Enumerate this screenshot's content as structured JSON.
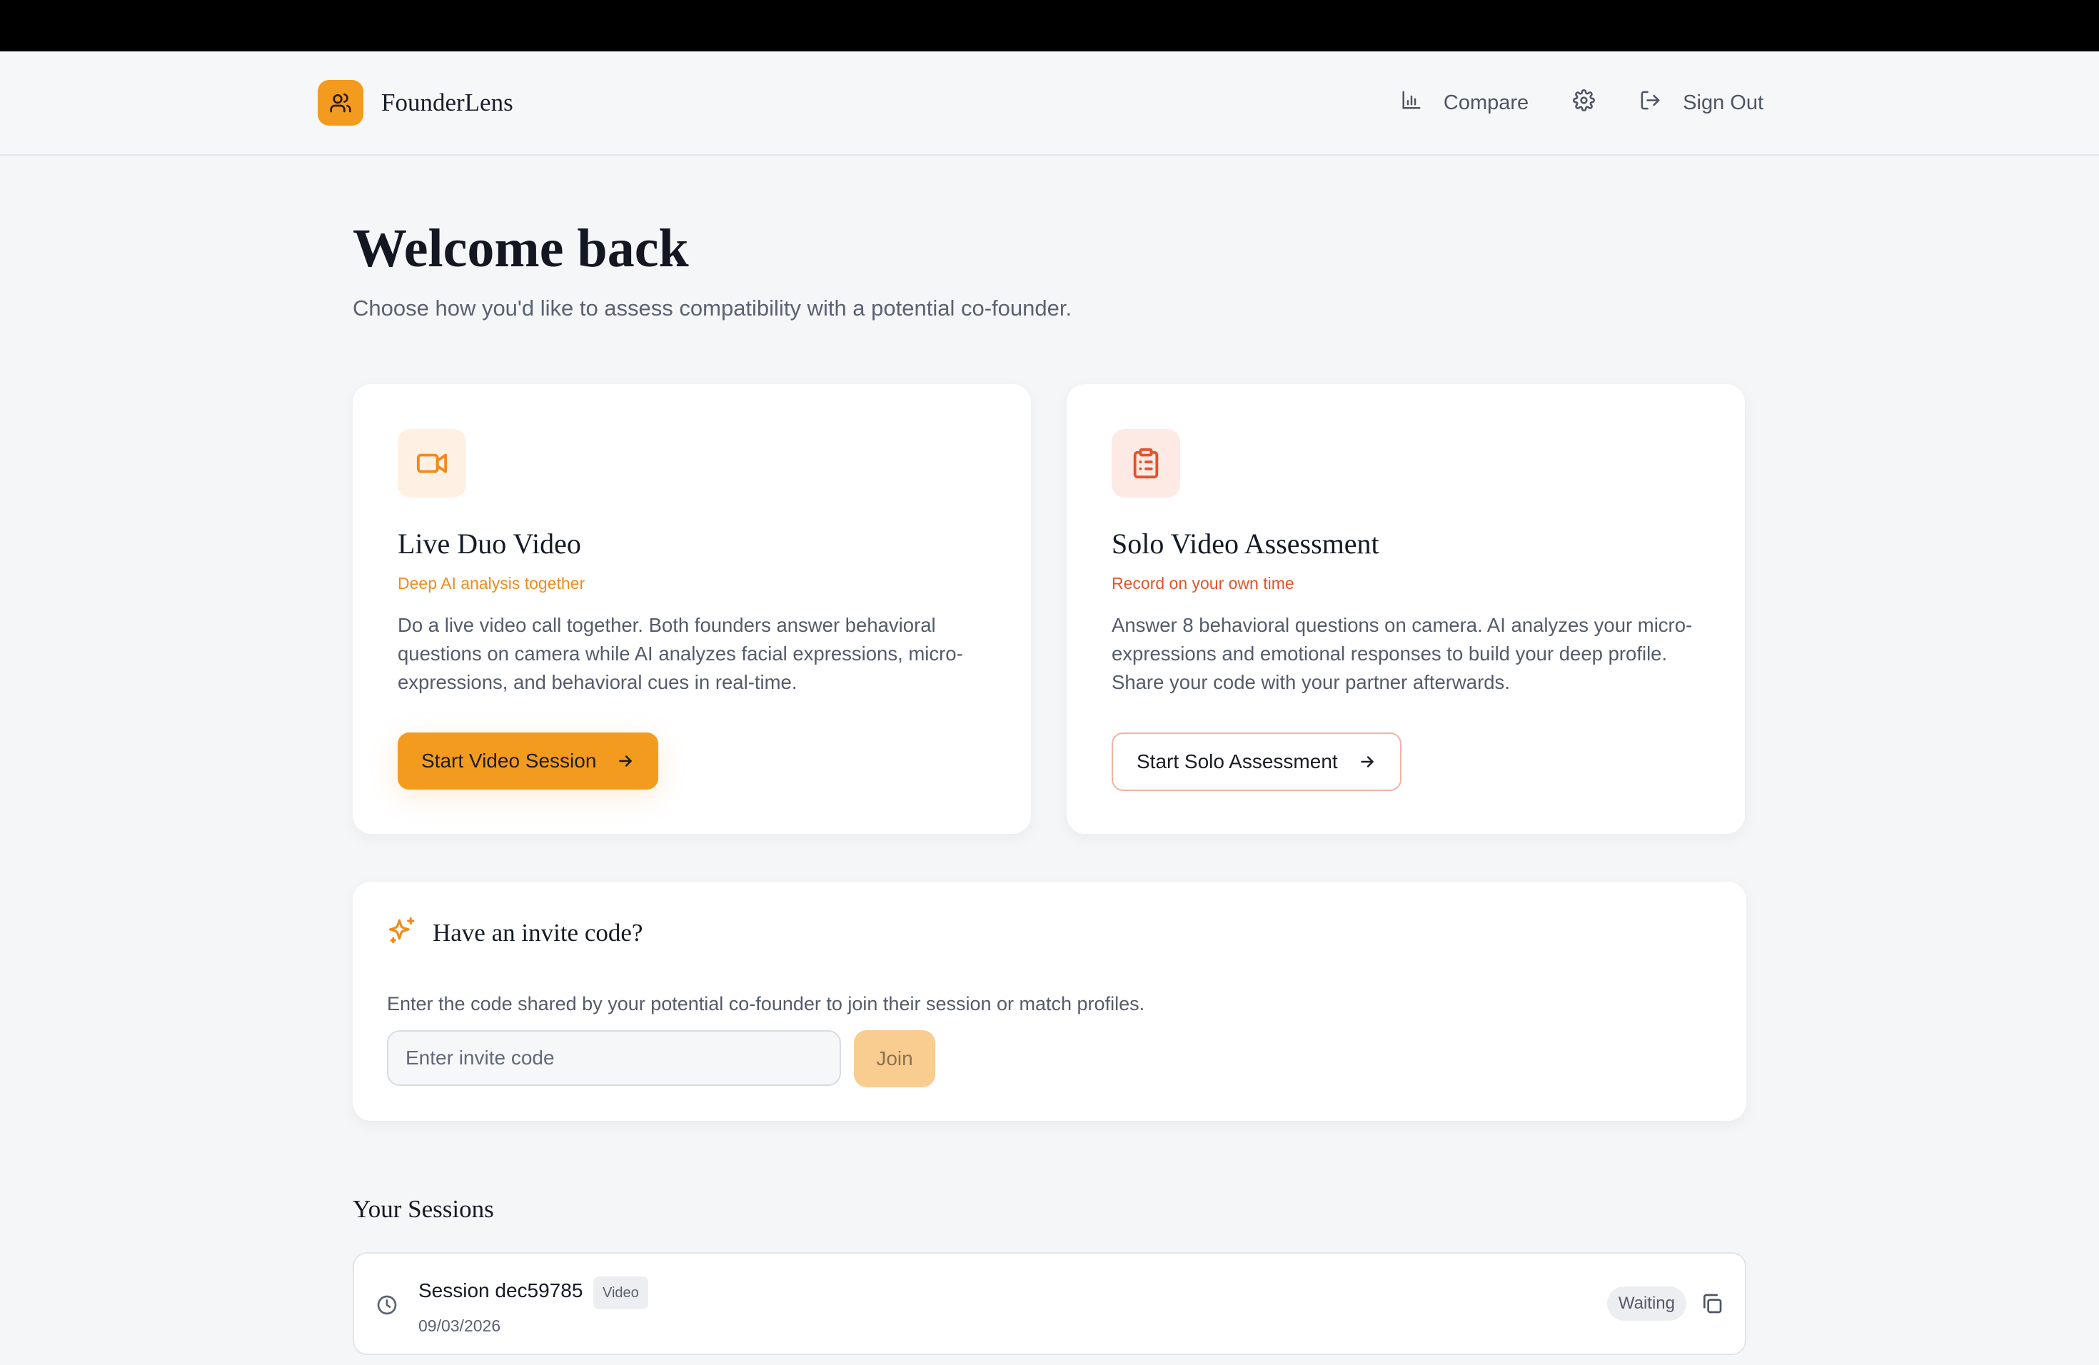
{
  "app": {
    "name": "FounderLens",
    "accent_color": "#f39b1f"
  },
  "nav": {
    "compare_label": "Compare",
    "settings_icon": "gear-icon",
    "signout_label": "Sign Out"
  },
  "hero": {
    "title": "Welcome back",
    "subtitle": "Choose how you'd like to assess compatibility with a potential co-founder."
  },
  "cards": [
    {
      "icon": "video-camera-icon",
      "title": "Live Duo Video",
      "tag": "Deep AI analysis together",
      "tag_color": "#f08a1c",
      "description": "Do a live video call together. Both founders answer behavioral questions on camera while AI analyzes facial expressions, micro-expressions, and behavioral cues in real-time.",
      "button_label": "Start Video Session"
    },
    {
      "icon": "clipboard-list-icon",
      "title": "Solo Video Assessment",
      "tag": "Record on your own time",
      "tag_color": "#e4532b",
      "description": "Answer 8 behavioral questions on camera. AI analyzes your micro-expressions and emotional responses to build your deep profile. Share your code with your partner afterwards.",
      "button_label": "Start Solo Assessment"
    }
  ],
  "invite": {
    "title": "Have an invite code?",
    "description": "Enter the code shared by your potential co-founder to join their session or match profiles.",
    "input_placeholder": "Enter invite code",
    "input_value": "",
    "join_label": "Join"
  },
  "sessions": {
    "title": "Your Sessions",
    "items": [
      {
        "name": "Session dec59785",
        "type": "Video",
        "date": "09/03/2026",
        "status": "Waiting"
      }
    ]
  }
}
